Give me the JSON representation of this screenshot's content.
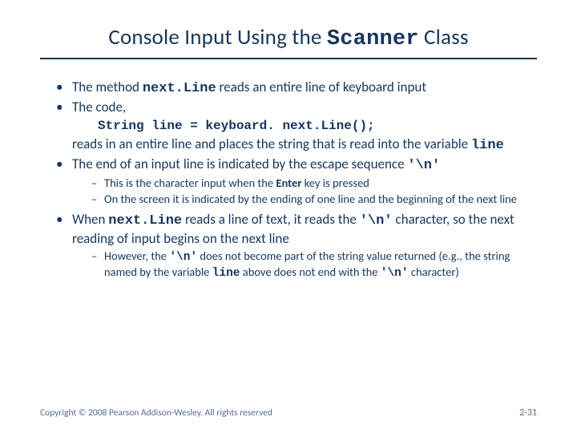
{
  "title_pre": "Console Input Using the ",
  "title_code": "Scanner",
  "title_post": " Class",
  "b1_pre": "The method ",
  "b1_code": "next.Line",
  "b1_post": " reads an entire line of keyboard input",
  "b2": "The code,",
  "code_line": "String line = keyboard. next.Line();",
  "b2_cont_pre": "reads in an entire line and places the string that is read into the variable ",
  "b2_cont_code": "line",
  "b3_pre": "The end of an input line is indicated by the escape sequence ",
  "b3_code": "'\\n'",
  "b3_s1_pre": "This is the character input when the ",
  "b3_s1_bold": "Enter",
  "b3_s1_post": " key is pressed",
  "b3_s2": "On the screen it is indicated by the ending of one line and the beginning of the next line",
  "b4_pre": "When ",
  "b4_c1": "next.Line",
  "b4_mid1": " reads a line of text, it reads the ",
  "b4_c2": "'\\n'",
  "b4_post": " character, so the next reading of input begins on the next line",
  "b4_s1_pre": "However, the ",
  "b4_s1_c1": "'\\n'",
  "b4_s1_mid1": " does not become part of the string value returned (e.g., the string named by the variable ",
  "b4_s1_c2": "line",
  "b4_s1_mid2": " above does not end with the ",
  "b4_s1_c3": "'\\n'",
  "b4_s1_post": " character)",
  "footer": "Copyright © 2008 Pearson Addison-Wesley. All rights reserved",
  "pagenum": "2-31"
}
